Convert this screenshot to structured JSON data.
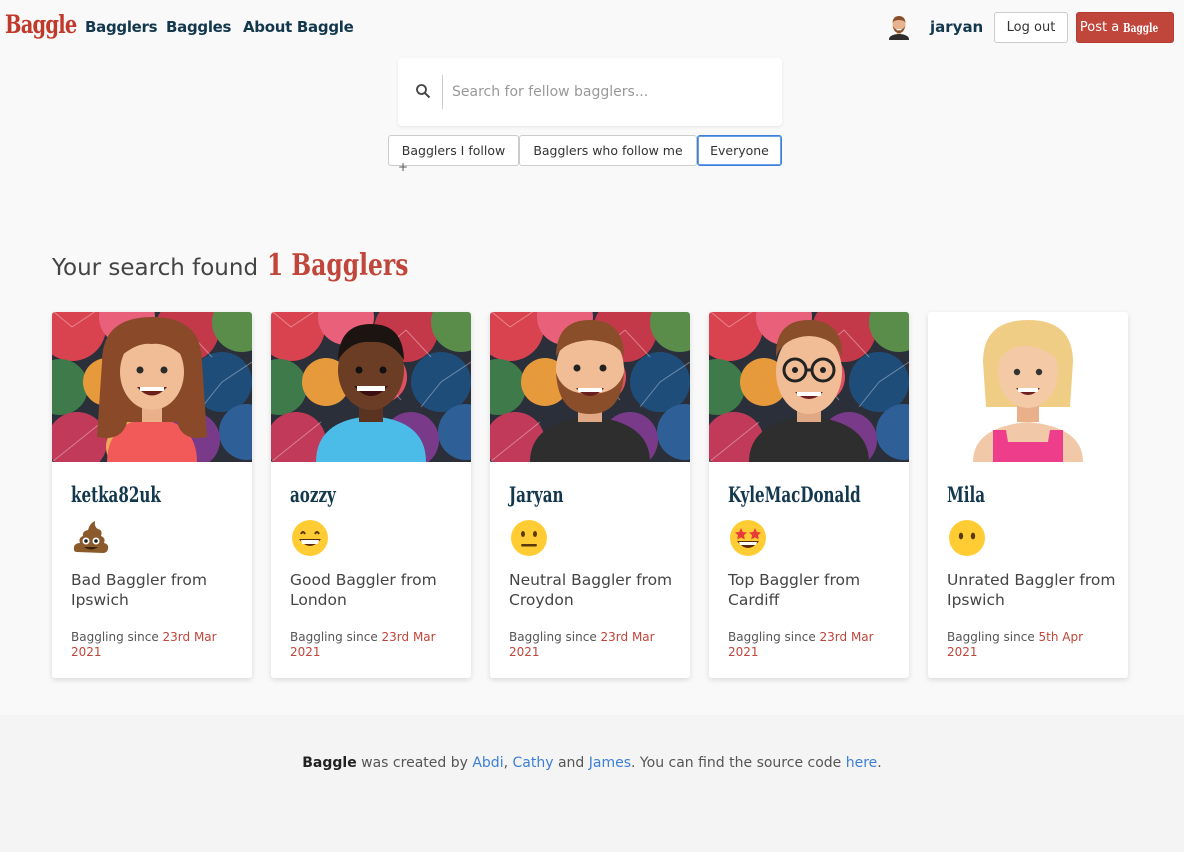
{
  "nav": {
    "logo": "Baggle",
    "links": [
      "Bagglers",
      "Baggles",
      "About Baggle"
    ],
    "username": "jaryan",
    "logout_label": "Log out",
    "post_prefix": "Post a",
    "post_brand": "Baggle"
  },
  "search": {
    "placeholder": "Search for fellow bagglers...",
    "filters": [
      "Bagglers I follow",
      "Bagglers who follow me",
      "Everyone"
    ],
    "active_filter": "Everyone",
    "plus": "+"
  },
  "results": {
    "prefix": "Your search found",
    "count_label": "1 Bagglers"
  },
  "cards": [
    {
      "name": "ketka82uk",
      "emoji": "pile-of-poo",
      "desc": "Bad Baggler from Ipswich",
      "since_label": "Baggling since",
      "since_date": "23rd Mar 2021"
    },
    {
      "name": "aozzy",
      "emoji": "grinning-face",
      "desc": "Good Baggler from London",
      "since_label": "Baggling since",
      "since_date": "23rd Mar 2021"
    },
    {
      "name": "Jaryan",
      "emoji": "neutral-face",
      "desc": "Neutral Baggler from Croydon",
      "since_label": "Baggling since",
      "since_date": "23rd Mar 2021"
    },
    {
      "name": "KyleMacDonald",
      "emoji": "star-struck-face",
      "desc": "Top Baggler from Cardiff",
      "since_label": "Baggling since",
      "since_date": "23rd Mar 2021"
    },
    {
      "name": "Mila",
      "emoji": "face-without-mouth",
      "desc": "Unrated Baggler from Ipswich",
      "since_label": "Baggling since",
      "since_date": "5th Apr 2021"
    }
  ],
  "footer": {
    "brand": "Baggle",
    "created_by": "was created by",
    "authors": [
      "Abdi",
      "Cathy",
      "James"
    ],
    "comma": ",",
    "and": "and",
    "source_text": ". You can find the source code",
    "link_label": "here",
    "end": "."
  },
  "colors": {
    "brand_red": "#c0453a",
    "nav_text": "#13384e",
    "link_blue": "#3d7fd6"
  }
}
